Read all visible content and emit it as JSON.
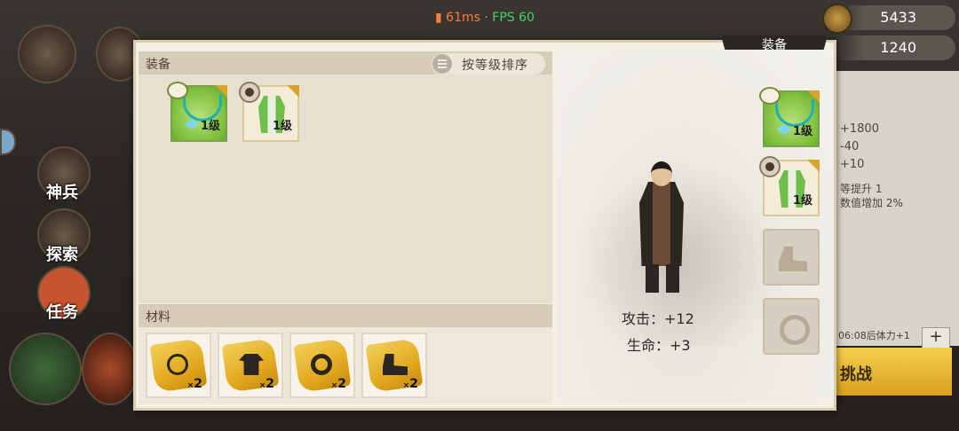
{
  "status": {
    "ping": "61ms",
    "separator": "·",
    "fps": "FPS 60"
  },
  "resources": {
    "gold": "5433",
    "gems": "1240"
  },
  "sidebar": {
    "items": [
      {
        "label": "神兵"
      },
      {
        "label": "探索"
      },
      {
        "label": "任务"
      }
    ]
  },
  "panel": {
    "tag": "装备"
  },
  "equipment_list": {
    "header": "装备",
    "sort_label": "按等级排序",
    "items": [
      {
        "type": "necklace",
        "level": "1级",
        "quality": "green"
      },
      {
        "type": "robe",
        "level": "1级",
        "quality": "white"
      }
    ]
  },
  "materials": {
    "header": "材料",
    "items": [
      {
        "type": "necklace-scroll",
        "count_prefix": "×",
        "count": "2"
      },
      {
        "type": "armor-scroll",
        "count_prefix": "×",
        "count": "2"
      },
      {
        "type": "ring-scroll",
        "count_prefix": "×",
        "count": "2"
      },
      {
        "type": "boots-scroll",
        "count_prefix": "×",
        "count": "2"
      }
    ]
  },
  "character": {
    "stats": [
      {
        "label": "攻击：",
        "value": "+12"
      },
      {
        "label": "生命：",
        "value": "+3"
      }
    ],
    "slots": [
      {
        "type": "necklace",
        "level": "1级",
        "equipped": true
      },
      {
        "type": "robe",
        "level": "1级",
        "equipped": true
      },
      {
        "type": "boots",
        "equipped": false
      },
      {
        "type": "ring",
        "equipped": false
      }
    ]
  },
  "background_panel": {
    "lines": [
      "+1800",
      "-40",
      "+10",
      "等提升 1",
      "数值增加 2%"
    ],
    "stamina": "06:08后体力+1",
    "plus_label": "+",
    "challenge": "挑战"
  },
  "colors": {
    "accent_gold": "#d8a42a",
    "green_quality": "#7cbe3a",
    "panel_bg": "#f4efe3"
  }
}
